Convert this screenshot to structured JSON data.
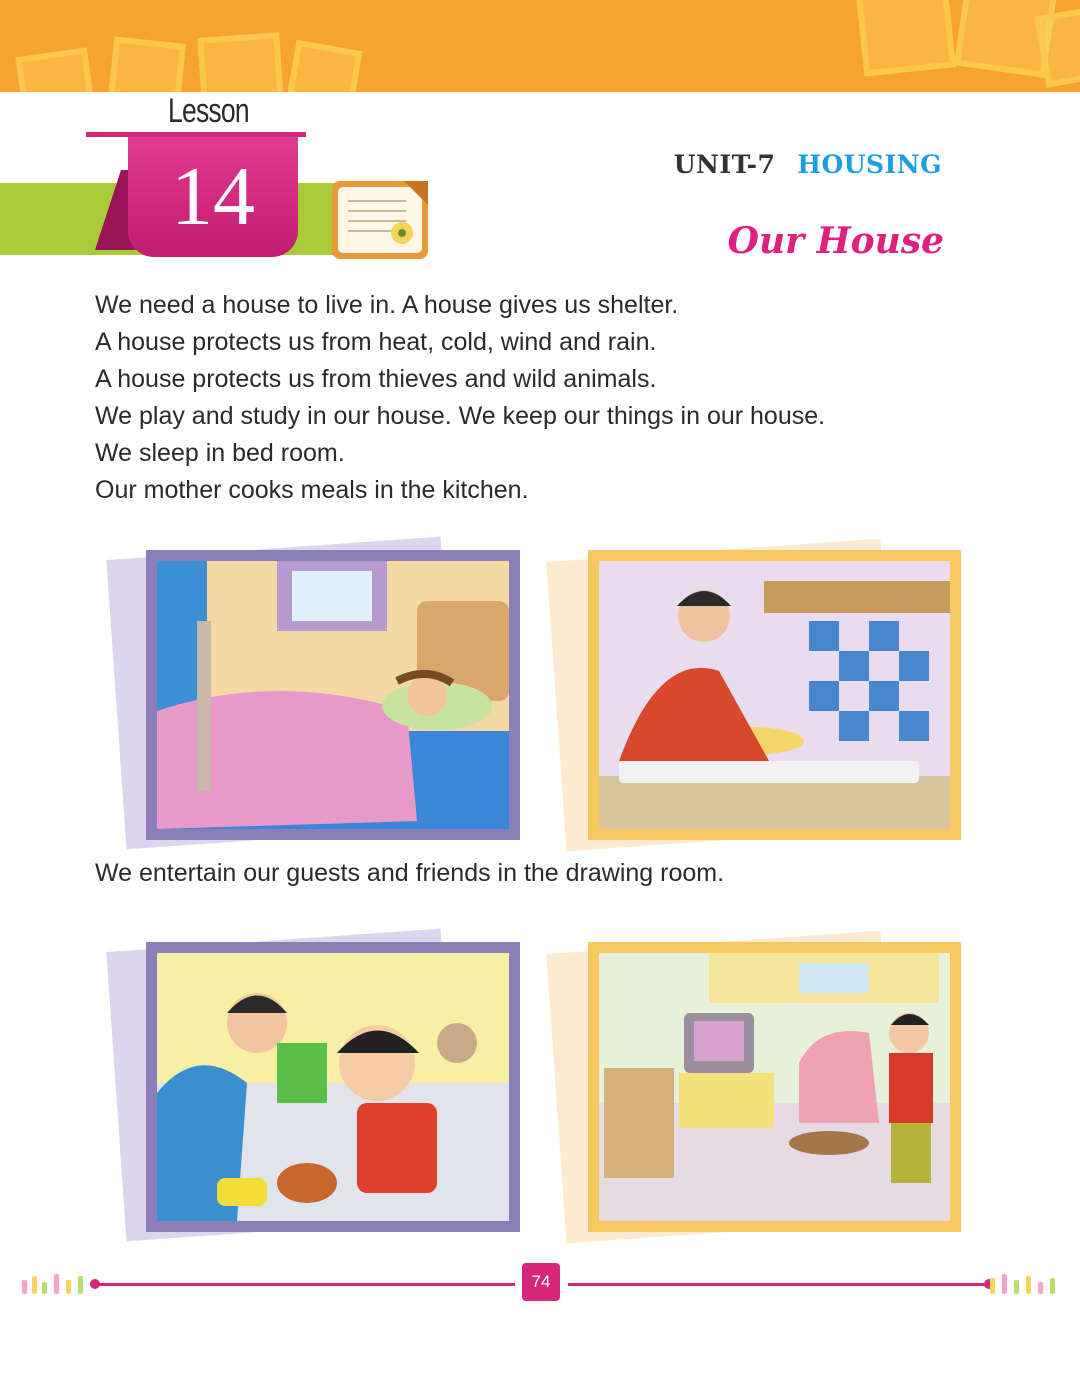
{
  "header": {
    "lesson_word": "Lesson",
    "lesson_number": "14",
    "unit_label": "UNIT-7",
    "unit_topic": "HOUSING",
    "title": "Our House"
  },
  "paragraph_1": {
    "lines": [
      "We need a house to live in. A house gives us shelter.",
      "A house protects us from heat, cold, wind and rain.",
      "A house protects us from thieves and wild animals.",
      "We play and study in our house. We keep our things in our house.",
      "We sleep in bed room.",
      "Our mother cooks meals in the kitchen."
    ]
  },
  "paragraph_2": {
    "lines": [
      "We entertain our guests and friends in the drawing room."
    ]
  },
  "footer": {
    "page_number": "74"
  },
  "colors": {
    "banner": "#f7a331",
    "accent_pink": "#d6267a",
    "title_pink": "#e0207d",
    "topic_blue": "#1b9fe0",
    "lesson_green": "#a9cb37",
    "frame_purple": "#8b7fb7",
    "frame_orange": "#f7c85f"
  },
  "icons": {
    "lesson_icon": "notebook-pencil-icon"
  }
}
